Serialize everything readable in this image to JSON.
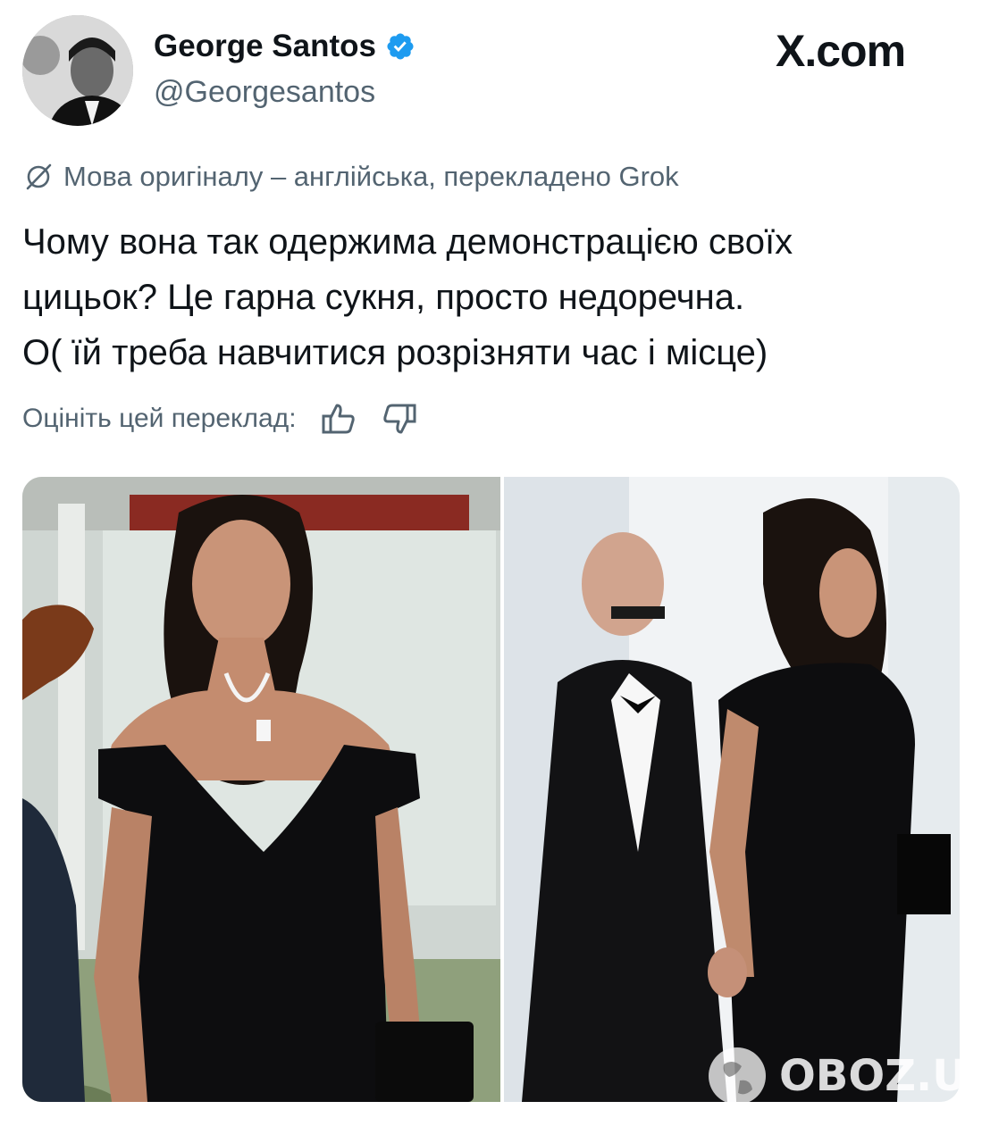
{
  "author": {
    "name": "George Santos",
    "handle": "@Georgesantos",
    "verified": true
  },
  "source_brand": "X.com",
  "translation_note": "Мова оригіналу – англійська, перекладено Grok",
  "tweet": {
    "lines": [
      "Чому вона так одержима демонстрацією своїх",
      "цицьок? Це гарна сукня, просто недоречна.",
      "О( їй треба навчитися розрізняти час і місце)"
    ]
  },
  "rate_translation": {
    "label": "Оцініть цей переклад:"
  },
  "watermark": "OBOZ.UA",
  "colors": {
    "verified_blue": "#1d9bf0",
    "secondary_text": "#536471",
    "primary_text": "#0f1419"
  },
  "icons": {
    "verified": "verified-badge-icon",
    "translate": "translate-globe-icon",
    "thumbs_up": "thumbs-up-icon",
    "thumbs_down": "thumbs-down-icon"
  }
}
